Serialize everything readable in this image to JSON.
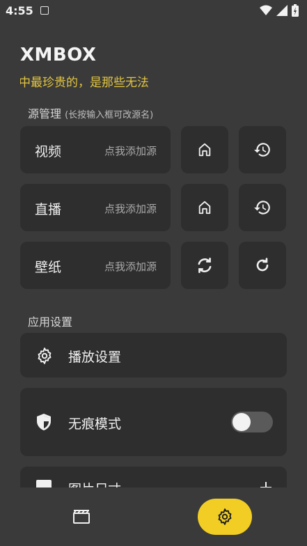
{
  "status_bar": {
    "time": "4:55"
  },
  "app": {
    "title": "XMBOX",
    "marquee_text": "中最珍贵的，是那些无法",
    "accent_color": "#f2ce24"
  },
  "source_section": {
    "title": "源管理",
    "hint": "(长按输入框可改源名)",
    "items": [
      {
        "label": "视频",
        "placeholder": "点我添加源",
        "actions": [
          "home-icon",
          "history-icon"
        ]
      },
      {
        "label": "直播",
        "placeholder": "点我添加源",
        "actions": [
          "home-icon",
          "history-icon"
        ]
      },
      {
        "label": "壁纸",
        "placeholder": "点我添加源",
        "actions": [
          "sync-icon",
          "refresh-icon"
        ]
      }
    ]
  },
  "app_settings": {
    "title": "应用设置",
    "items": [
      {
        "label": "播放设置",
        "icon": "gear-icon"
      },
      {
        "label": "无痕模式",
        "icon": "shield-icon",
        "toggle": false
      },
      {
        "label": "图片尺寸",
        "icon": "image-icon"
      }
    ]
  },
  "bottom_nav": {
    "items": [
      {
        "icon": "movie-icon",
        "active": false
      },
      {
        "icon": "settings-icon",
        "active": true
      }
    ]
  }
}
